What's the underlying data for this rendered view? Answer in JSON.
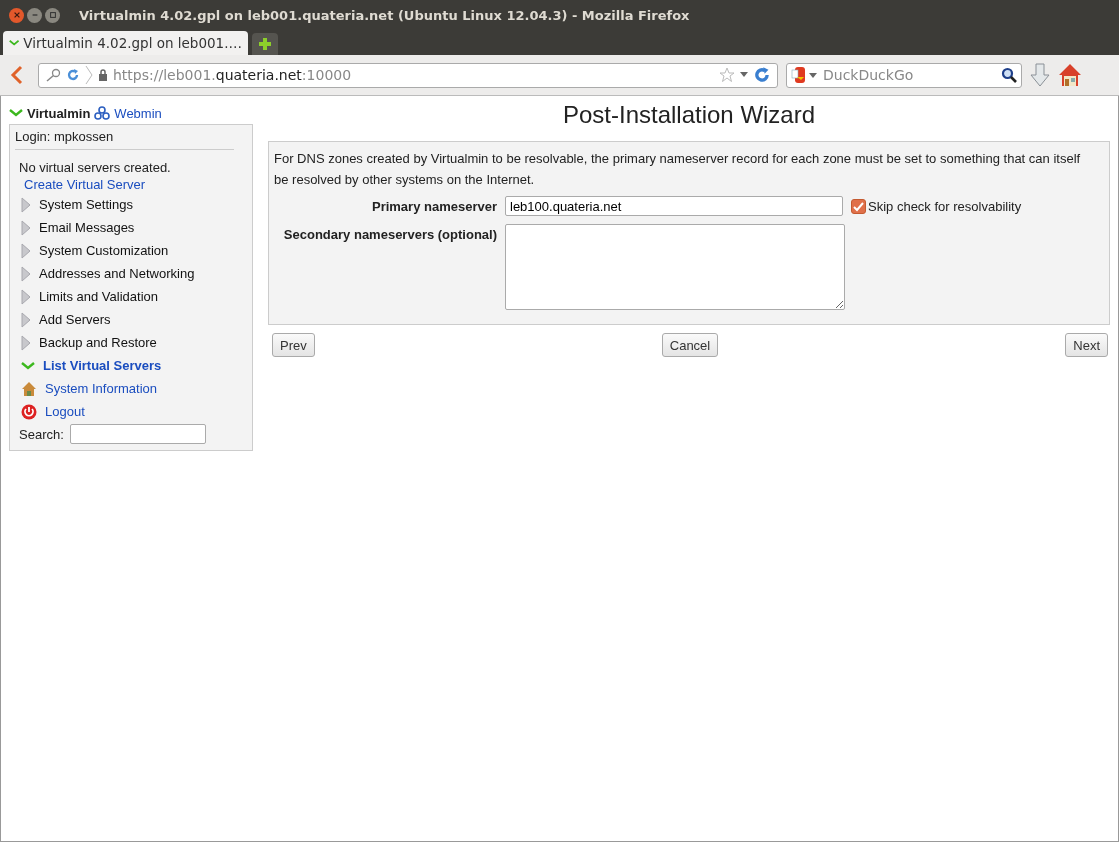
{
  "window": {
    "title": "Virtualmin 4.02.gpl on leb001.quateria.net (Ubuntu Linux 12.04.3) - Mozilla Firefox"
  },
  "tabs": [
    {
      "label": "Virtualmin 4.02.gpl on leb001.…",
      "selected": true
    }
  ],
  "address_bar": {
    "url_start": "https://leb001.",
    "url_domain": "quateria.net",
    "url_end": ":10000"
  },
  "search_bar": {
    "placeholder": "DuckDuckGo"
  },
  "sidebar": {
    "product": "Virtualmin",
    "switch_link": "Webmin",
    "login": "Login: mpkossen",
    "note": "No virtual servers created.",
    "create_link": "Create Virtual Server",
    "items": [
      {
        "label": "System Settings",
        "kind": "category"
      },
      {
        "label": "Email Messages",
        "kind": "category"
      },
      {
        "label": "System Customization",
        "kind": "category"
      },
      {
        "label": "Addresses and Networking",
        "kind": "category"
      },
      {
        "label": "Limits and Validation",
        "kind": "category"
      },
      {
        "label": "Add Servers",
        "kind": "category"
      },
      {
        "label": "Backup and Restore",
        "kind": "category"
      },
      {
        "label": "List Virtual Servers",
        "kind": "expanded"
      },
      {
        "label": "System Information",
        "kind": "home"
      },
      {
        "label": "Logout",
        "kind": "logout"
      }
    ],
    "search_label": "Search:"
  },
  "wizard": {
    "title": "Post-Installation Wizard",
    "description": "For DNS zones created by Virtualmin to be resolvable, the primary nameserver record for each zone must be set to something that can itself be resolved by other systems on the Internet.",
    "primary": {
      "label": "Primary nameserver",
      "value": "leb100.quateria.net"
    },
    "skip_check": {
      "label": "Skip check for resolvability",
      "checked": true
    },
    "secondary": {
      "label": "Secondary nameservers (optional)"
    },
    "buttons": {
      "prev": "Prev",
      "cancel": "Cancel",
      "next": "Next"
    }
  }
}
